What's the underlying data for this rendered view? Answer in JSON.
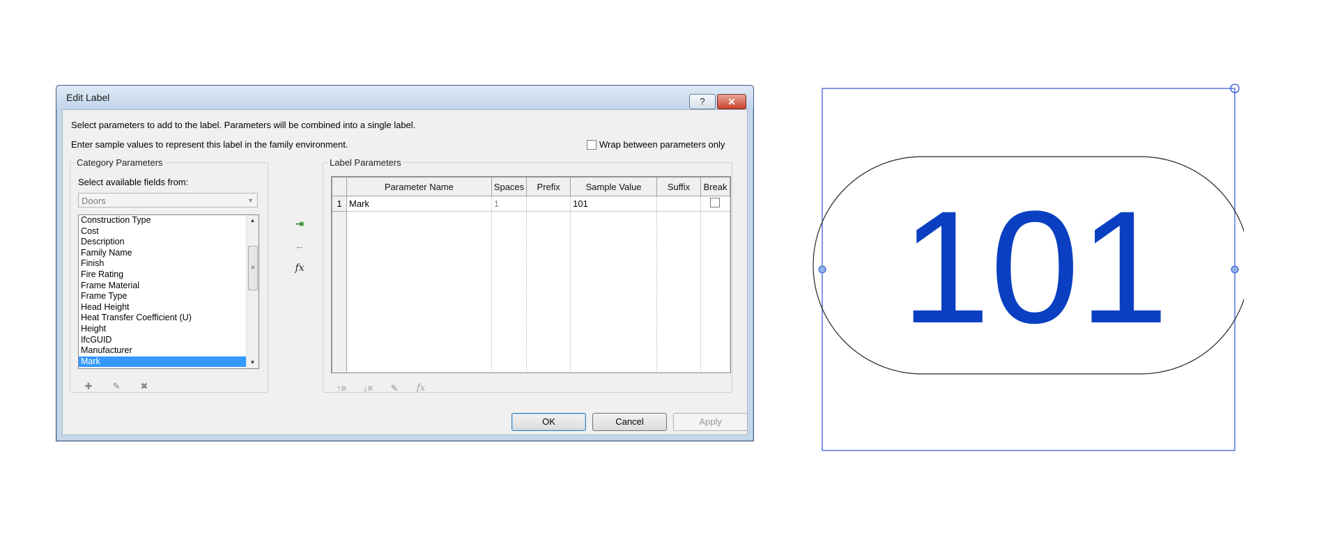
{
  "dialog": {
    "title": "Edit Label",
    "help_button": "?",
    "close_button": "✕",
    "intro_line1": "Select parameters to add to the label.  Parameters will be combined into a single label.",
    "intro_line2": "Enter sample values to represent this label in the family environment.",
    "wrap_label": "Wrap between parameters only",
    "category_group": {
      "legend": "Category Parameters",
      "select_label": "Select available fields from:",
      "dropdown_value": "Doors",
      "items": [
        "Construction Type",
        "Cost",
        "Description",
        "Family Name",
        "Finish",
        "Fire Rating",
        "Frame Material",
        "Frame Type",
        "Head Height",
        "Heat Transfer Coefficient (U)",
        "Height",
        "IfcGUID",
        "Manufacturer",
        "Mark"
      ],
      "selected_item": "Mark"
    },
    "label_group": {
      "legend": "Label Parameters",
      "columns": [
        "",
        "Parameter Name",
        "Spaces",
        "Prefix",
        "Sample Value",
        "Suffix",
        "Break"
      ],
      "rows": [
        {
          "index": "1",
          "parameter_name": "Mark",
          "spaces": "1",
          "prefix": "",
          "sample_value": "101",
          "suffix": "",
          "break": false
        }
      ]
    },
    "buttons": {
      "ok": "OK",
      "cancel": "Cancel",
      "apply": "Apply"
    }
  },
  "preview": {
    "label_text": "101",
    "label_color": "#0a3fc2",
    "frame_color": "#2f4fd6"
  }
}
